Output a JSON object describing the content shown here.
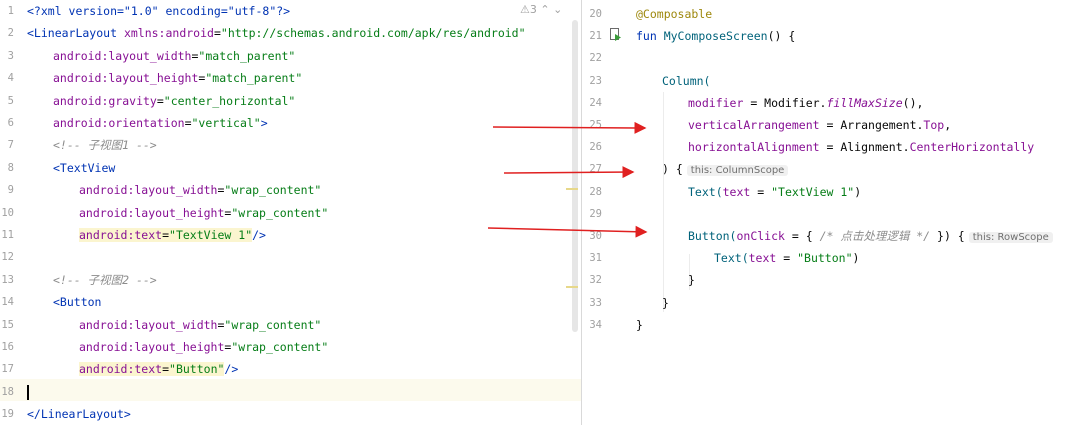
{
  "left_editor": {
    "warning_count": "3",
    "lines": [
      {
        "n": "1",
        "segments": [
          {
            "t": "<?xml version=\"1.0\" encoding=\"utf-8\"?>",
            "c": "tag"
          }
        ]
      },
      {
        "n": "2",
        "segments": [
          {
            "t": "<LinearLayout ",
            "c": "tag"
          },
          {
            "t": "xmlns:android",
            "c": "attr"
          },
          {
            "t": "=",
            "c": ""
          },
          {
            "t": "\"http://schemas.android.com/apk/res/android\"",
            "c": "str"
          }
        ]
      },
      {
        "n": "3",
        "indent": 1,
        "segments": [
          {
            "t": "android:layout_width",
            "c": "attr"
          },
          {
            "t": "=",
            "c": ""
          },
          {
            "t": "\"match_parent\"",
            "c": "str"
          }
        ]
      },
      {
        "n": "4",
        "indent": 1,
        "segments": [
          {
            "t": "android:layout_height",
            "c": "attr"
          },
          {
            "t": "=",
            "c": ""
          },
          {
            "t": "\"match_parent\"",
            "c": "str"
          }
        ]
      },
      {
        "n": "5",
        "indent": 1,
        "segments": [
          {
            "t": "android:gravity",
            "c": "attr"
          },
          {
            "t": "=",
            "c": ""
          },
          {
            "t": "\"center_horizontal\"",
            "c": "str"
          }
        ]
      },
      {
        "n": "6",
        "indent": 1,
        "segments": [
          {
            "t": "android:orientation",
            "c": "attr"
          },
          {
            "t": "=",
            "c": ""
          },
          {
            "t": "\"vertical\"",
            "c": "str"
          },
          {
            "t": ">",
            "c": "tag"
          }
        ]
      },
      {
        "n": "7",
        "indent": 1,
        "segments": [
          {
            "t": "<!-- 子视图1 -->",
            "c": "cmt"
          }
        ]
      },
      {
        "n": "8",
        "indent": 1,
        "segments": [
          {
            "t": "<TextView",
            "c": "tag"
          }
        ]
      },
      {
        "n": "9",
        "indent": 2,
        "segments": [
          {
            "t": "android:layout_width",
            "c": "attr"
          },
          {
            "t": "=",
            "c": ""
          },
          {
            "t": "\"wrap_content\"",
            "c": "str"
          }
        ]
      },
      {
        "n": "10",
        "indent": 2,
        "segments": [
          {
            "t": "android:layout_height",
            "c": "attr"
          },
          {
            "t": "=",
            "c": ""
          },
          {
            "t": "\"wrap_content\"",
            "c": "str"
          }
        ]
      },
      {
        "n": "11",
        "indent": 2,
        "segments": [
          {
            "t": "android:text",
            "c": "attr hl"
          },
          {
            "t": "=",
            "c": "hl"
          },
          {
            "t": "\"TextView 1\"",
            "c": "str hl"
          },
          {
            "t": "/>",
            "c": "tag"
          }
        ]
      },
      {
        "n": "12",
        "segments": []
      },
      {
        "n": "13",
        "indent": 1,
        "segments": [
          {
            "t": "<!-- 子视图2 -->",
            "c": "cmt"
          }
        ]
      },
      {
        "n": "14",
        "indent": 1,
        "segments": [
          {
            "t": "<Button",
            "c": "tag"
          }
        ]
      },
      {
        "n": "15",
        "indent": 2,
        "segments": [
          {
            "t": "android:layout_width",
            "c": "attr"
          },
          {
            "t": "=",
            "c": ""
          },
          {
            "t": "\"wrap_content\"",
            "c": "str"
          }
        ]
      },
      {
        "n": "16",
        "indent": 2,
        "segments": [
          {
            "t": "android:layout_height",
            "c": "attr"
          },
          {
            "t": "=",
            "c": ""
          },
          {
            "t": "\"wrap_content\"",
            "c": "str"
          }
        ]
      },
      {
        "n": "17",
        "indent": 2,
        "segments": [
          {
            "t": "android:text",
            "c": "attr hl"
          },
          {
            "t": "=",
            "c": "hl"
          },
          {
            "t": "\"Button\"",
            "c": "str hl"
          },
          {
            "t": "/>",
            "c": "tag"
          }
        ]
      },
      {
        "n": "18",
        "caret": true,
        "segments": []
      },
      {
        "n": "19",
        "segments": [
          {
            "t": "</LinearLayout>",
            "c": "tag"
          }
        ]
      }
    ]
  },
  "right_editor": {
    "lines": [
      {
        "n": "20",
        "segments": [
          {
            "t": "@Composable",
            "c": "ann"
          }
        ]
      },
      {
        "n": "21",
        "segments": [
          {
            "t": "fun ",
            "c": "kw"
          },
          {
            "t": "MyComposeScreen",
            "c": "fn"
          },
          {
            "t": "() {",
            "c": ""
          }
        ]
      },
      {
        "n": "22",
        "segments": []
      },
      {
        "n": "23",
        "indent": 1,
        "segments": [
          {
            "t": "Column(",
            "c": "fn"
          }
        ]
      },
      {
        "n": "24",
        "indent": 2,
        "segments": [
          {
            "t": "modifier",
            "c": "attr"
          },
          {
            "t": " = Modifier.",
            "c": ""
          },
          {
            "t": "fillMaxSize",
            "c": "it"
          },
          {
            "t": "(),",
            "c": ""
          }
        ]
      },
      {
        "n": "25",
        "indent": 2,
        "segments": [
          {
            "t": "verticalArrangement",
            "c": "attr"
          },
          {
            "t": " = Arrangement.",
            "c": ""
          },
          {
            "t": "Top",
            "c": "attr"
          },
          {
            "t": ",",
            "c": ""
          }
        ]
      },
      {
        "n": "26",
        "indent": 2,
        "segments": [
          {
            "t": "horizontalAlignment",
            "c": "attr"
          },
          {
            "t": " = Alignment.",
            "c": ""
          },
          {
            "t": "CenterHorizontally",
            "c": "attr"
          }
        ]
      },
      {
        "n": "27",
        "indent": 1,
        "segments": [
          {
            "t": ") {",
            "c": ""
          }
        ],
        "hint": "this: ColumnScope"
      },
      {
        "n": "28",
        "indent": 2,
        "segments": [
          {
            "t": "Text(",
            "c": "fn"
          },
          {
            "t": "text",
            "c": "attr"
          },
          {
            "t": " = ",
            "c": ""
          },
          {
            "t": "\"TextView 1\"",
            "c": "str"
          },
          {
            "t": ")",
            "c": ""
          }
        ]
      },
      {
        "n": "29",
        "segments": []
      },
      {
        "n": "30",
        "indent": 2,
        "segments": [
          {
            "t": "Button(",
            "c": "fn"
          },
          {
            "t": "onClick",
            "c": "attr"
          },
          {
            "t": " = { ",
            "c": ""
          },
          {
            "t": "/* 点击处理逻辑 */",
            "c": "cmt"
          },
          {
            "t": " }) {",
            "c": ""
          }
        ],
        "hint": "this: RowScope"
      },
      {
        "n": "31",
        "indent": 3,
        "segments": [
          {
            "t": "Text(",
            "c": "fn"
          },
          {
            "t": "text",
            "c": "attr"
          },
          {
            "t": " = ",
            "c": ""
          },
          {
            "t": "\"Button\"",
            "c": "str"
          },
          {
            "t": ")",
            "c": ""
          }
        ]
      },
      {
        "n": "32",
        "indent": 2,
        "segments": [
          {
            "t": "}",
            "c": ""
          }
        ]
      },
      {
        "n": "33",
        "indent": 1,
        "segments": [
          {
            "t": "}",
            "c": ""
          }
        ]
      },
      {
        "n": "34",
        "segments": [
          {
            "t": "}",
            "c": ""
          }
        ]
      }
    ]
  },
  "colors": {
    "arrow": "#e02020"
  }
}
